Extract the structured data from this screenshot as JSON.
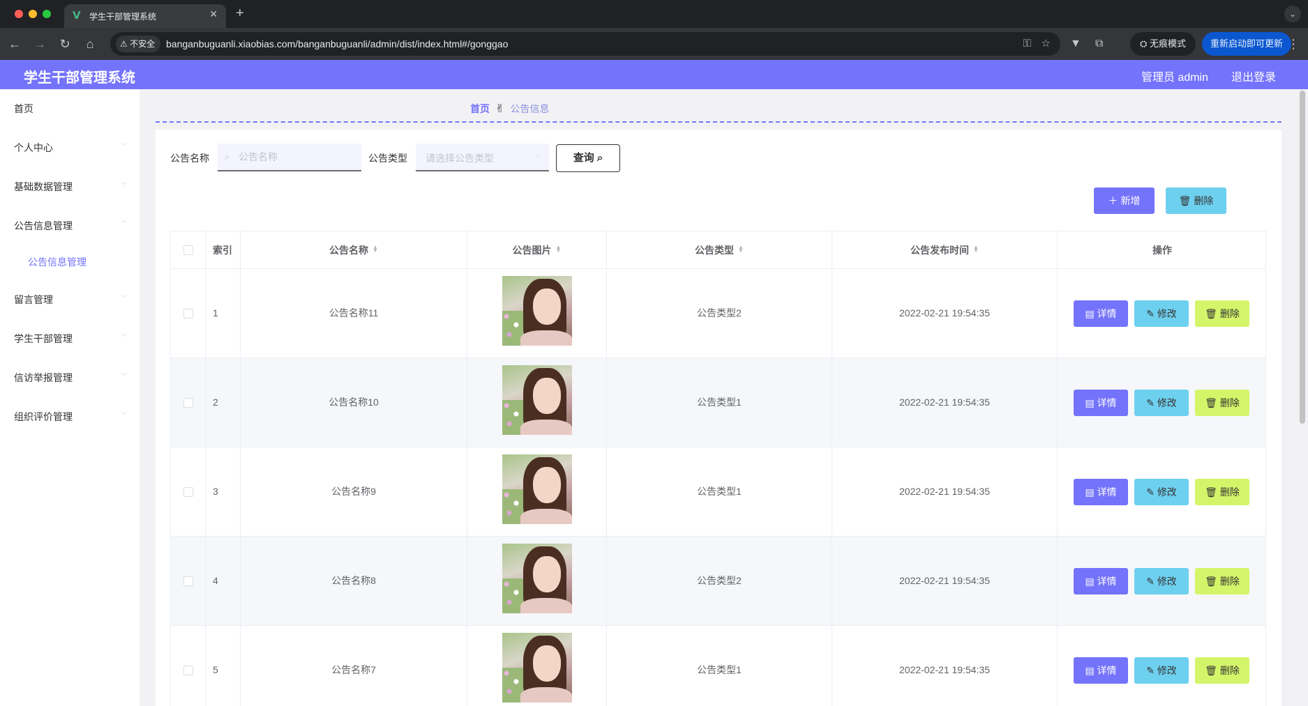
{
  "browser": {
    "tab_title": "学生干部管理系统",
    "tab_close": "✕",
    "new_tab": "+",
    "tab_menu": "⌄",
    "insecure_label": "不安全",
    "url": "banganbuguanli.xiaobias.com/banganbuguanli/admin/dist/index.html#/gonggao",
    "incognito_label": "无痕模式",
    "relaunch_label": "重新启动即可更新",
    "icons": [
      "back-icon",
      "forward-icon",
      "reload-icon",
      "home-icon",
      "key-icon",
      "star-icon",
      "vue-devtools-icon",
      "extensions-icon",
      "incognito-icon",
      "more-icon"
    ]
  },
  "header": {
    "title": "学生干部管理系统",
    "user_label": "管理员 admin",
    "logout_label": "退出登录",
    "accent_color": "#7473fb"
  },
  "sidebar": {
    "items": [
      {
        "label": "首页",
        "has_arrow": false
      },
      {
        "label": "个人中心",
        "has_arrow": true
      },
      {
        "label": "基础数据管理",
        "has_arrow": true
      },
      {
        "label": "公告信息管理",
        "has_arrow": true,
        "expanded": true
      },
      {
        "label": "留言管理",
        "has_arrow": true
      },
      {
        "label": "学生干部管理",
        "has_arrow": true
      },
      {
        "label": "信访举报管理",
        "has_arrow": true
      },
      {
        "label": "组织评价管理",
        "has_arrow": true
      }
    ],
    "submenu": {
      "label": "公告信息管理",
      "active": true
    }
  },
  "breadcrumb": {
    "home": "首页",
    "separator": "✌",
    "current": "公告信息"
  },
  "search": {
    "name_label": "公告名称",
    "name_placeholder": "公告名称",
    "type_label": "公告类型",
    "type_placeholder": "请选择公告类型",
    "query_label": "查询"
  },
  "actions": {
    "add_label": "新增",
    "delete_label": "删除"
  },
  "table": {
    "columns": [
      "索引",
      "公告名称",
      "公告图片",
      "公告类型",
      "公告发布时间",
      "操作"
    ],
    "row_buttons": {
      "detail": "详情",
      "edit": "修改",
      "delete": "删除"
    },
    "rows": [
      {
        "index": "1",
        "name": "公告名称11",
        "type": "公告类型2",
        "time": "2022-02-21 19:54:35"
      },
      {
        "index": "2",
        "name": "公告名称10",
        "type": "公告类型1",
        "time": "2022-02-21 19:54:35"
      },
      {
        "index": "3",
        "name": "公告名称9",
        "type": "公告类型1",
        "time": "2022-02-21 19:54:35"
      },
      {
        "index": "4",
        "name": "公告名称8",
        "type": "公告类型2",
        "time": "2022-02-21 19:54:35"
      },
      {
        "index": "5",
        "name": "公告名称7",
        "type": "公告类型1",
        "time": "2022-02-21 19:54:35"
      }
    ]
  },
  "colors": {
    "detail_button": "#7473fb",
    "edit_button": "#6ed0ef",
    "delete_button": "#d4f569"
  }
}
